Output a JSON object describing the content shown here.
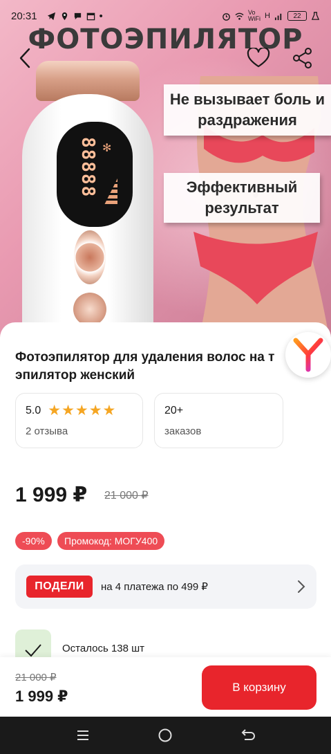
{
  "status_bar": {
    "time": "20:31",
    "battery": "22",
    "network_vo": "Vo",
    "network_wifi": "WiFi",
    "network_h": "H"
  },
  "hero": {
    "title": "ФОТОЭПИЛЯТОР",
    "callout_1": "Не вызывает боль и раздражения",
    "callout_2": "Эффективный результат"
  },
  "product": {
    "title": "Фотоэпилятор для удаления волос на т эпилятор женский",
    "rating": "5.0",
    "stars": "★★★★★",
    "reviews": "2 отзыва",
    "orders_count": "20+",
    "orders_label": "заказов",
    "price": "1 999 ₽",
    "old_price": "21 000 ₽",
    "discount_badge": "-90%",
    "promo_badge": "Промокод: МОГУ400",
    "split": {
      "logo": "ПОДЕЛИ",
      "text": "на 4 платежа по 499 ₽"
    },
    "stock_text": "Осталось 138 шт"
  },
  "buy_bar": {
    "old_price": "21 000 ₽",
    "price": "1 999 ₽",
    "cart_button": "В корзину"
  },
  "icons": {
    "back": "back-arrow-icon",
    "favorite": "heart-icon",
    "share": "share-icon",
    "yandex": "yandex-logo-icon",
    "chevron": "chevron-right-icon",
    "check": "check-icon"
  },
  "colors": {
    "accent": "#e8252c",
    "badge": "#ee4c55",
    "star": "#f5a623"
  }
}
